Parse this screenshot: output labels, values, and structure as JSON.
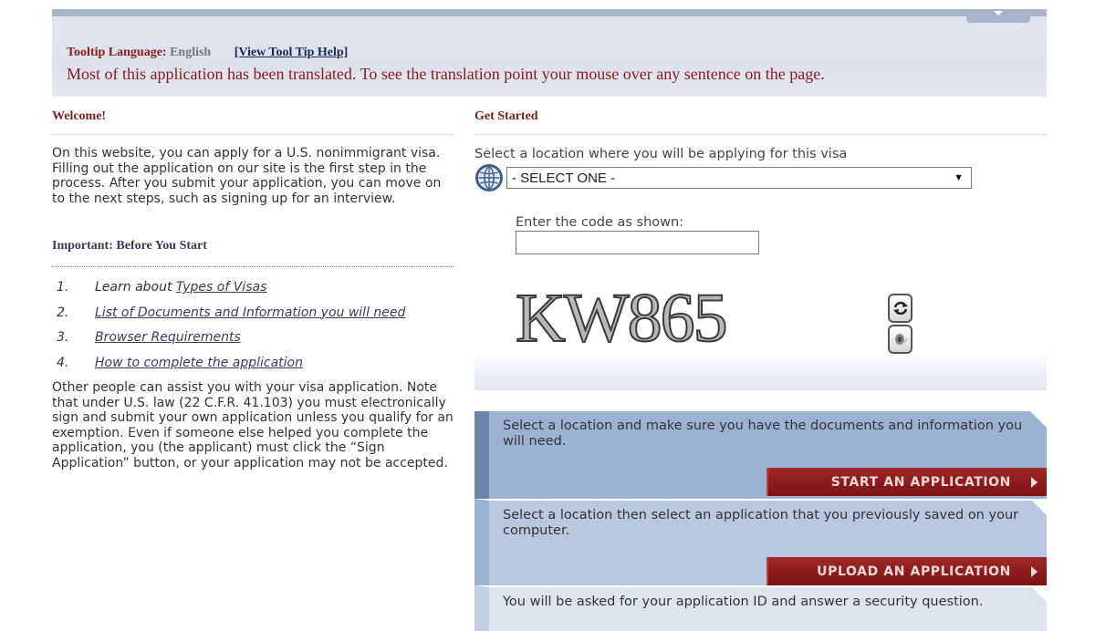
{
  "banner": {
    "tooltip_label": "Tooltip Language:",
    "tooltip_language": "English",
    "help_link": "[View Tool Tip Help]",
    "translation_note": "Most of this application has been translated. To see the translation point your mouse over any sentence on the page."
  },
  "welcome": {
    "heading": "Welcome!",
    "text": "On this website, you can apply for a U.S. nonimmigrant visa. Filling out the application on our site is the first step in the process. After you submit your application, you can move on to the next steps, such as signing up for an interview."
  },
  "important": {
    "heading": "Important: Before You Start",
    "steps": [
      {
        "num": "1.",
        "prefix": "Learn about ",
        "link": "Types of Visas"
      },
      {
        "num": "2.",
        "prefix": "",
        "link": "List of Documents and Information you will need"
      },
      {
        "num": "3.",
        "prefix": "",
        "link": "Browser Requirements"
      },
      {
        "num": "4.",
        "prefix": "",
        "link": "How to complete the application"
      }
    ],
    "other_text": "Other people can assist you with your visa application. Note that under U.S. law (22 C.F.R. 41.103) you must electronically sign and submit your own application unless you qualify for an exemption. Even if someone else helped you complete the application, you (the applicant) must click the “Sign Application” button, or your application may not be accepted."
  },
  "get_started": {
    "heading": "Get Started",
    "location_label": "Select a location where you will be applying for this visa",
    "location_selected": "- SELECT ONE -",
    "code_label": "Enter the code as shown:",
    "code_value": "",
    "captcha_text": "KW865"
  },
  "panels": [
    {
      "text": "Select a location and make sure you have the documents and information you will need.",
      "button": "START AN APPLICATION"
    },
    {
      "text": "Select a location then select an application that you previously saved on your computer.",
      "button": "UPLOAD AN APPLICATION"
    },
    {
      "text": "You will be asked for your application ID and answer a security question."
    }
  ],
  "colors": {
    "heading_red": "#7a1f1f",
    "button_red": "#8a1a1a",
    "panel_blue": "#9cb2d3"
  }
}
